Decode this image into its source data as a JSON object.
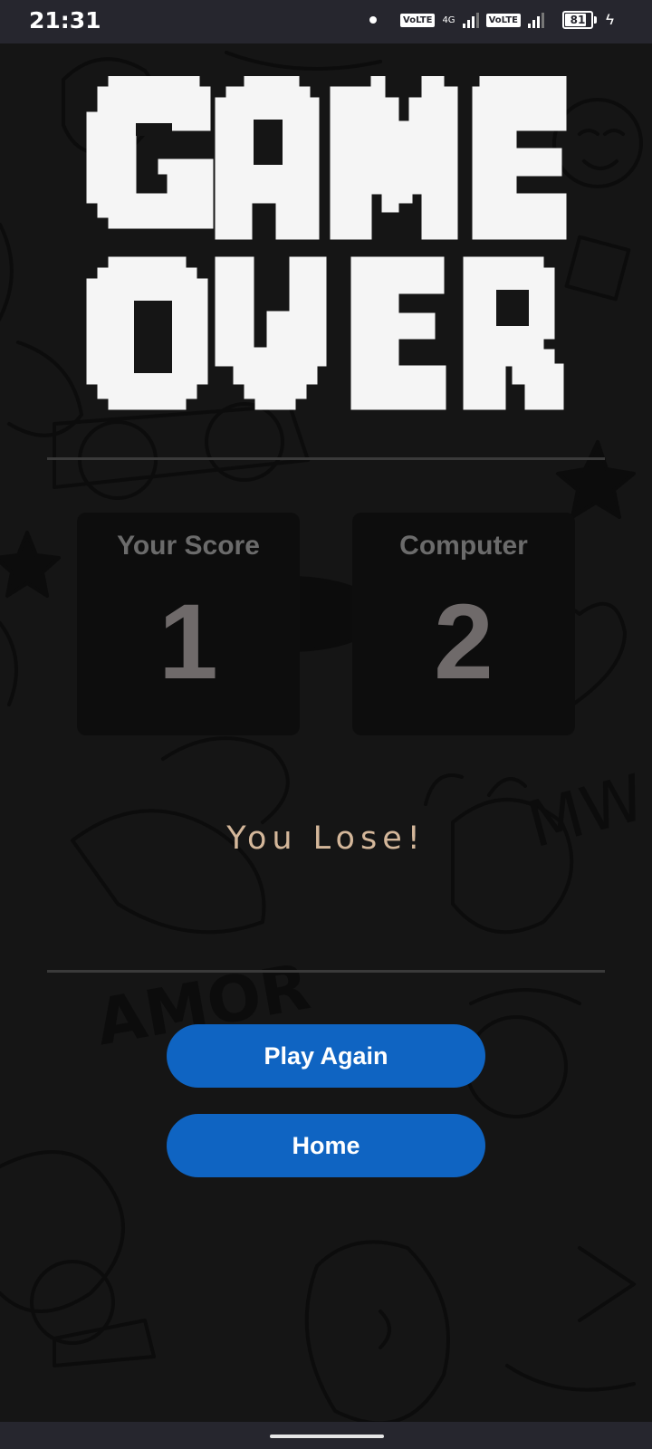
{
  "status_bar": {
    "time": "21:31",
    "sim1_label": "VoLTE",
    "network_type": "4G",
    "sim2_label": "VoLTE",
    "battery_percent": "81"
  },
  "title": {
    "line1": "GAME",
    "line2": "OVER"
  },
  "scores": {
    "player": {
      "label": "Your Score",
      "value": "1"
    },
    "computer": {
      "label": "Computer",
      "value": "2"
    }
  },
  "result": "You Lose!",
  "buttons": {
    "play_again": "Play Again",
    "home": "Home"
  },
  "colors": {
    "background": "#151515",
    "title_text": "#f5f5f5",
    "card": "#0d0d0d",
    "result_text": "#d4b79a",
    "button": "#0f64c2"
  }
}
